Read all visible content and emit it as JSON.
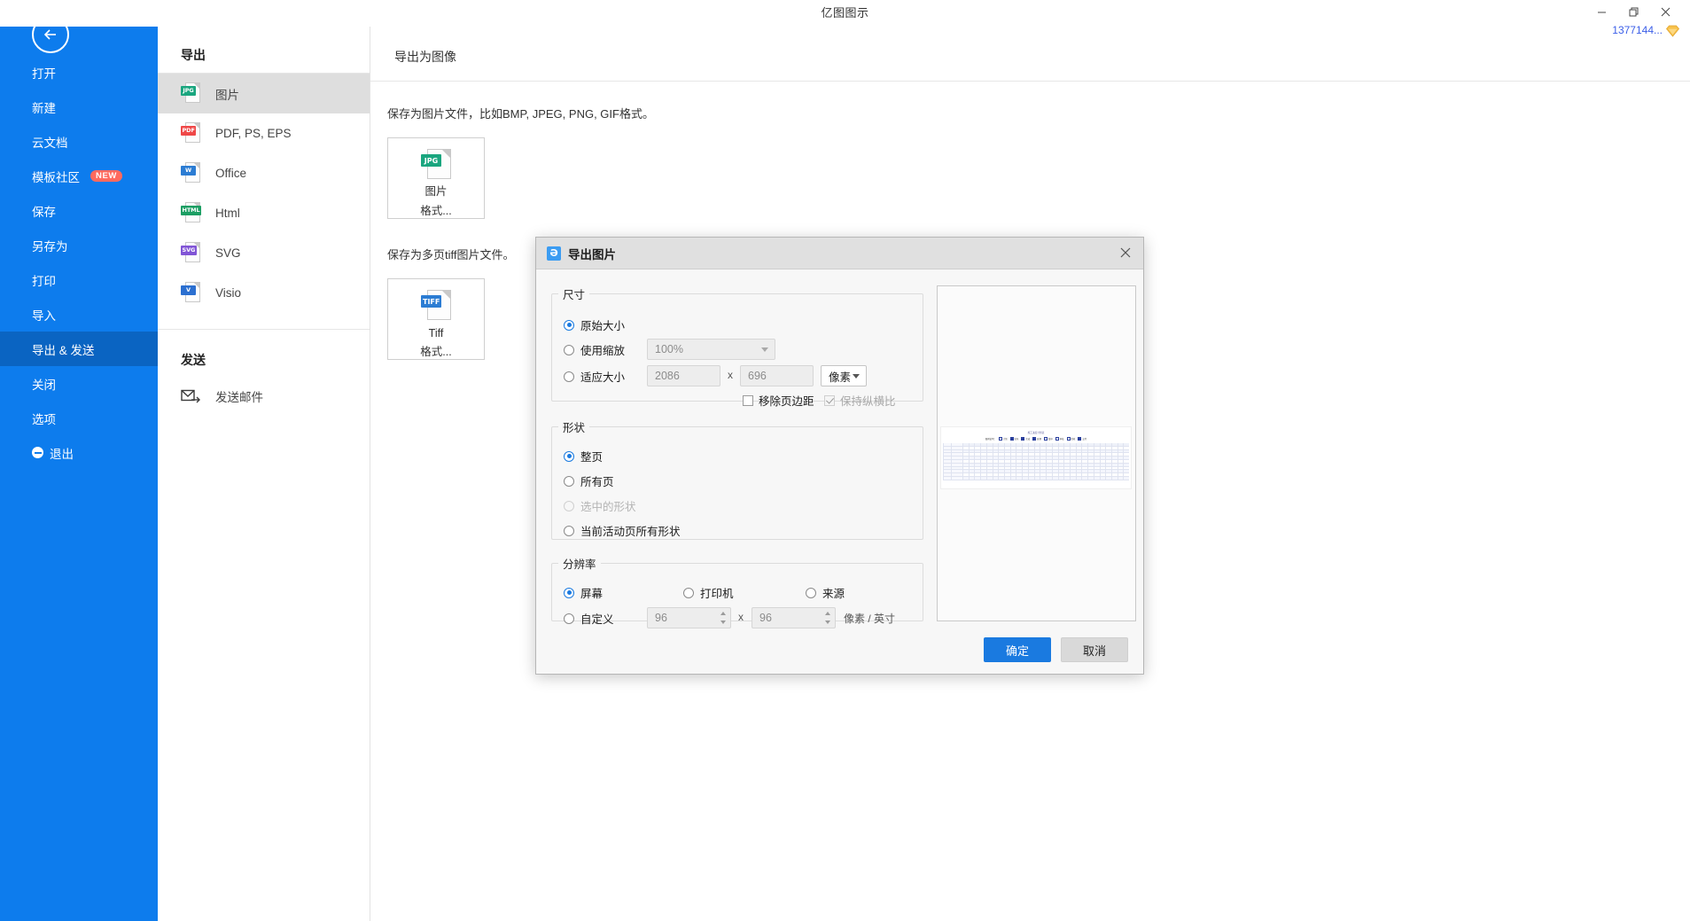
{
  "window": {
    "title": "亿图图示",
    "minimize_label": "–",
    "maximize_label": "❐",
    "close_label": "✕",
    "account_id": "1377144...",
    "vip_badge_color": "#f5b63c"
  },
  "sidebar": {
    "accent_color": "#0d7ced",
    "active_color": "#0a64c2",
    "back_label": "back-arrow",
    "items": [
      {
        "label": "打开",
        "active": false,
        "badge": null
      },
      {
        "label": "新建",
        "active": false,
        "badge": null
      },
      {
        "label": "云文档",
        "active": false,
        "badge": null
      },
      {
        "label": "模板社区",
        "active": false,
        "badge": "NEW"
      },
      {
        "label": "保存",
        "active": false,
        "badge": null
      },
      {
        "label": "另存为",
        "active": false,
        "badge": null
      },
      {
        "label": "打印",
        "active": false,
        "badge": null
      },
      {
        "label": "导入",
        "active": false,
        "badge": null
      },
      {
        "label": "导出 & 发送",
        "active": true,
        "badge": null
      },
      {
        "label": "关闭",
        "active": false,
        "badge": null
      },
      {
        "label": "选项",
        "active": false,
        "badge": null
      },
      {
        "label": "退出",
        "active": false,
        "badge": null
      }
    ]
  },
  "export_column": {
    "export_heading": "导出",
    "formats": [
      {
        "label": "图片",
        "tag": "JPG",
        "color": "#1aa67f",
        "selected": true
      },
      {
        "label": "PDF, PS, EPS",
        "tag": "PDF",
        "color": "#ef4848",
        "selected": false
      },
      {
        "label": "Office",
        "tag": "W",
        "color": "#2b7cd3",
        "selected": false
      },
      {
        "label": "Html",
        "tag": "HTML",
        "color": "#1b9e63",
        "selected": false
      },
      {
        "label": "SVG",
        "tag": "SVG",
        "color": "#8155d6",
        "selected": false
      },
      {
        "label": "Visio",
        "tag": "V",
        "color": "#2b6fd0",
        "selected": false
      }
    ],
    "send_heading": "发送",
    "send_items": [
      {
        "label": "发送邮件",
        "icon": "mail-icon"
      }
    ]
  },
  "main": {
    "title": "导出为图像",
    "image_desc": "保存为图片文件，比如BMP, JPEG, PNG, GIF格式。",
    "image_tile": {
      "tag": "JPG",
      "color": "#1aa67f",
      "line1": "图片",
      "line2": "格式..."
    },
    "tiff_desc": "保存为多页tiff图片文件。",
    "tiff_tile": {
      "tag": "TIFF",
      "color": "#2b7cd3",
      "line1": "Tiff",
      "line2": "格式..."
    }
  },
  "dialog": {
    "title": "导出图片",
    "logo_glyph": "Ə",
    "close_label": "✕",
    "size_group": {
      "legend": "尺寸",
      "original_label": "原始大小",
      "original_selected": true,
      "scale_label": "使用缩放",
      "scale_selected": false,
      "scale_value": "100%",
      "fit_label": "适应大小",
      "fit_selected": false,
      "width_value": "2086",
      "x_separator": "x",
      "height_value": "696",
      "unit_value": "像素",
      "remove_margin_label": "移除页边距",
      "remove_margin_checked": false,
      "keep_ratio_label": "保持纵横比",
      "keep_ratio_checked": true,
      "keep_ratio_disabled": true
    },
    "shape_group": {
      "legend": "形状",
      "options": [
        {
          "label": "整页",
          "selected": true,
          "disabled": false
        },
        {
          "label": "所有页",
          "selected": false,
          "disabled": false
        },
        {
          "label": "选中的形状",
          "selected": false,
          "disabled": true
        },
        {
          "label": "当前活动页所有形状",
          "selected": false,
          "disabled": false
        }
      ]
    },
    "resolution_group": {
      "legend": "分辨率",
      "options": [
        {
          "label": "屏幕",
          "selected": true
        },
        {
          "label": "打印机",
          "selected": false
        },
        {
          "label": "来源",
          "selected": false
        }
      ],
      "custom_label": "自定义",
      "custom_selected": false,
      "dpi_x": "96",
      "x_separator": "x",
      "dpi_y": "96",
      "unit_label": "像素 / 英寸"
    },
    "preview": {
      "doc_title": "施工进度计划表",
      "legend": [
        {
          "text": "图例说明：",
          "swatch": null
        },
        {
          "text": "计划",
          "swatch": "open"
        },
        {
          "text": "实际",
          "swatch": "solid"
        },
        {
          "text": "完成",
          "swatch": "solid"
        },
        {
          "text": "延期",
          "swatch": "solid"
        },
        {
          "text": "暂停",
          "swatch": "open"
        },
        {
          "text": "审核",
          "swatch": "open"
        },
        {
          "text": "验收",
          "swatch": "open"
        },
        {
          "text": "交付",
          "swatch": "solid"
        }
      ]
    },
    "ok_label": "确定",
    "cancel_label": "取消"
  }
}
